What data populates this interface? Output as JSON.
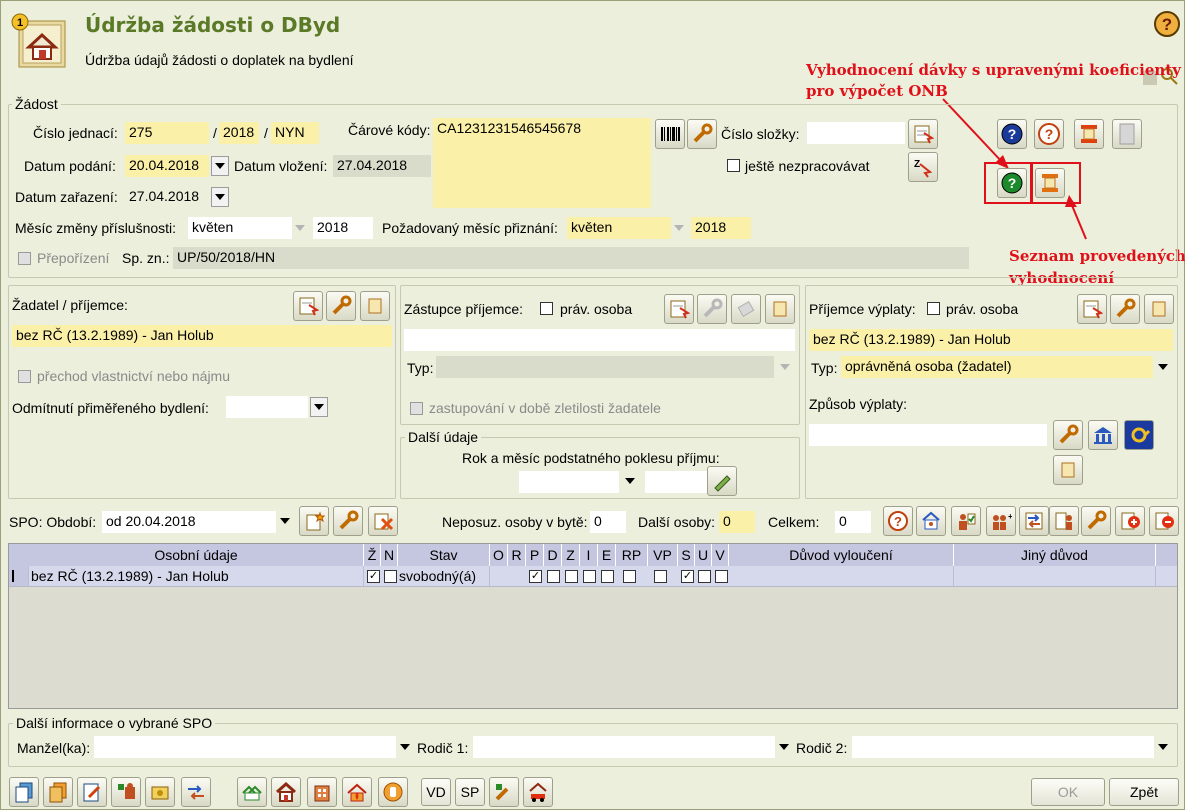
{
  "header": {
    "title": "Údržba žádosti o DByd",
    "subtitle": "Údržba údajů žádosti o doplatek na bydlení"
  },
  "annotations": {
    "top": "Vyhodnocení dávky s upravenými koeficienty",
    "top2": "pro výpočet ONB",
    "bottom": "Seznam provedených",
    "bottom2": "vyhodnocení",
    "color": "#e0101a"
  },
  "zadost": {
    "legend": "Žádost",
    "cislo_jednaci_label": "Číslo jednací:",
    "cj1": "275",
    "sep1": "/",
    "cj2": "2018",
    "sep2": "/",
    "cj3": "NYN",
    "carove_kody_label": "Čárové kódy:",
    "carove_kody_value": "CA1231231546545678",
    "cislo_slozky_label": "Číslo složky:",
    "cislo_slozky_value": "",
    "datum_podani_label": "Datum podání:",
    "datum_podani": "20.04.2018",
    "datum_vlozeni_label": "Datum vložení:",
    "datum_vlozeni": "27.04.2018",
    "nezpracovavat_label": "ještě nezpracovávat",
    "datum_zarazeni_label": "Datum zařazení:",
    "datum_zarazeni": "27.04.2018",
    "mesic_zmeny_label": "Měsíc změny příslušnosti:",
    "mesic_zmeny": "květen",
    "mesic_zmeny_rok": "2018",
    "pozadovany_label": "Požadovaný měsíc přiznání:",
    "pozadovany": "květen",
    "pozadovany_rok": "2018",
    "prepocet_label": "Přepořízení",
    "spzn_label": "Sp. zn.:",
    "spzn": "UP/50/2018/HN"
  },
  "zadatel": {
    "label": "Žadatel / příjemce:",
    "value": "bez RČ (13.2.1989) - Jan Holub",
    "prechod_label": "přechod vlastnictví nebo nájmu",
    "odmitnuti_label": "Odmítnutí přiměřeného bydlení:",
    "odmitnuti": ""
  },
  "zastupce": {
    "label": "Zástupce příjemce:",
    "prav_osoba": "práv. osoba",
    "value": "",
    "typ_label": "Typ:",
    "typ": "",
    "zastupovani_label": "zastupování v době zletilosti žadatele"
  },
  "dalsi": {
    "legend": "Další údaje",
    "rok_label": "Rok a měsíc podstatného poklesu příjmu:"
  },
  "prijemce": {
    "label": "Příjemce výplaty:",
    "prav_osoba": "práv. osoba",
    "value": "bez RČ (13.2.1989) - Jan Holub",
    "typ_label": "Typ:",
    "typ": "oprávněná osoba (žadatel)",
    "zpusob_label": "Způsob výplaty:",
    "zpusob": ""
  },
  "spo": {
    "obdobi_label": "SPO: Období:",
    "obdobi": "od 20.04.2018",
    "neposuz_label": "Neposuz. osoby v bytě:",
    "neposuz": "0",
    "dalsi_label": "Další osoby:",
    "dalsi": "0",
    "celkem_label": "Celkem:",
    "celkem": "0"
  },
  "table": {
    "columns": [
      "Osobní údaje",
      "Ž",
      "N",
      "Stav",
      "O",
      "R",
      "P",
      "D",
      "Z",
      "I",
      "E",
      "RP",
      "VP",
      "S",
      "U",
      "V",
      "Důvod vyloučení",
      "Jiný důvod"
    ],
    "row": {
      "name": "bez RČ (13.2.1989) - Jan Holub",
      "stav": "svobodný(á)",
      "zn": [
        true,
        false
      ],
      "flags": [
        null,
        null,
        true,
        false,
        false,
        false,
        false,
        false,
        false,
        true,
        false,
        false
      ]
    }
  },
  "dalsi_info": {
    "legend": "Další informace o vybrané SPO",
    "manzel_label": "Manžel(ka):",
    "rodic1_label": "Rodič 1:",
    "rodic2_label": "Rodič 2:"
  },
  "bottom": {
    "vd": "VD",
    "sp": "SP",
    "ok": "OK",
    "zpet": "Zpět"
  }
}
